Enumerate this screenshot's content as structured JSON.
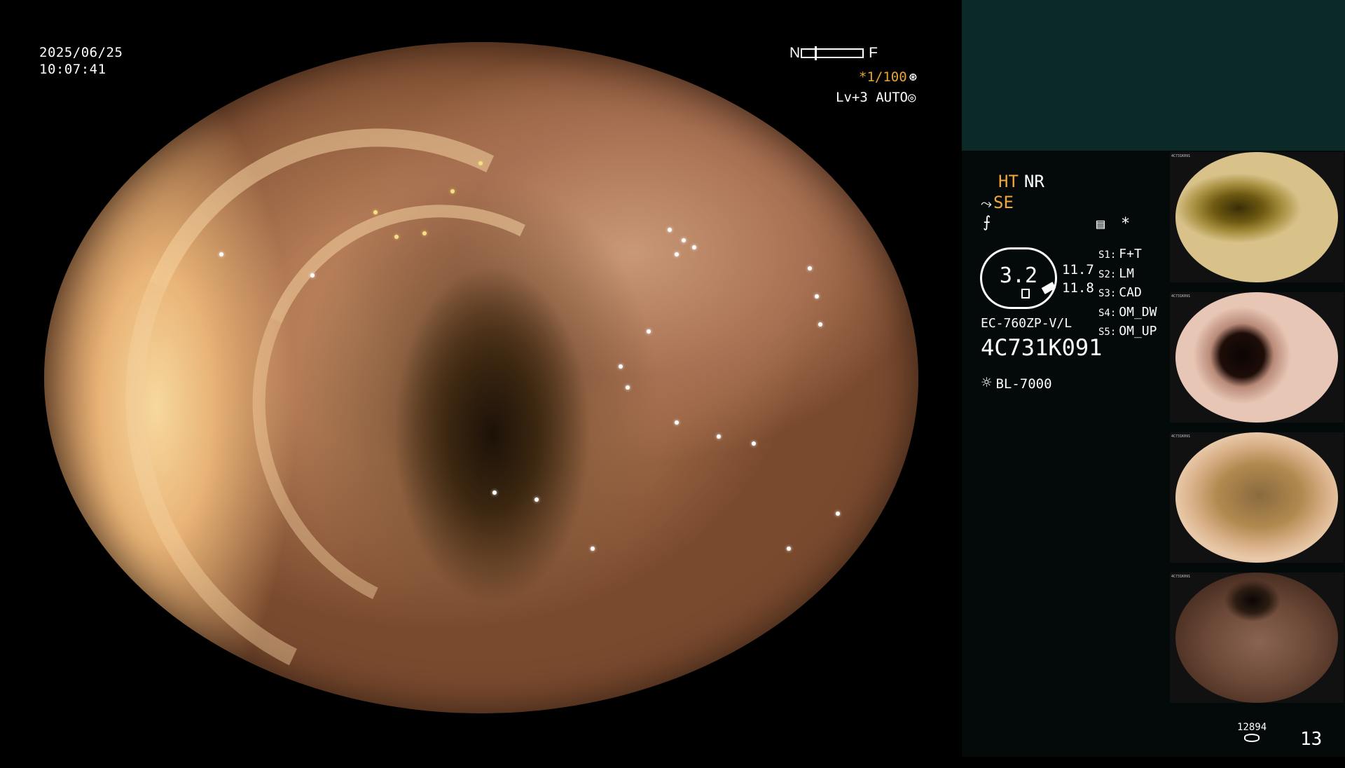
{
  "main": {
    "date": "2025/06/25",
    "time": "10:07:41",
    "focus_near": "N",
    "focus_far": "F",
    "shutter": "*1/100",
    "shutter_icon": "aperture-icon",
    "level": "Lv+3",
    "auto_label": "AUTO",
    "auto_icon": "iris-icon"
  },
  "side": {
    "ht": "HT",
    "nr": "NR",
    "se": "SE",
    "se_icon": "scope-tip-icon",
    "sharpness_icon": "sharpness-icon",
    "menu_icon": "settings-panel-icon",
    "star": "*",
    "dial_value": "3.2",
    "dial_num_1": "11.7",
    "dial_num_2": "11.8",
    "scope_model": "EC-760ZP-V/L",
    "serial": "4C731K091",
    "light_source": "BL-7000",
    "light_icon": "lamp-icon",
    "switches": [
      {
        "key": "S1:",
        "value": "F+T"
      },
      {
        "key": "S2:",
        "value": "LM"
      },
      {
        "key": "S3:",
        "value": "CAD"
      },
      {
        "key": "S4:",
        "value": "OM_DW"
      },
      {
        "key": "S5:",
        "value": "OM_UP"
      }
    ],
    "thumbnail_label": "4C731K091",
    "storage_count": "12894",
    "storage_icon": "storage-icon",
    "image_count": "13"
  }
}
